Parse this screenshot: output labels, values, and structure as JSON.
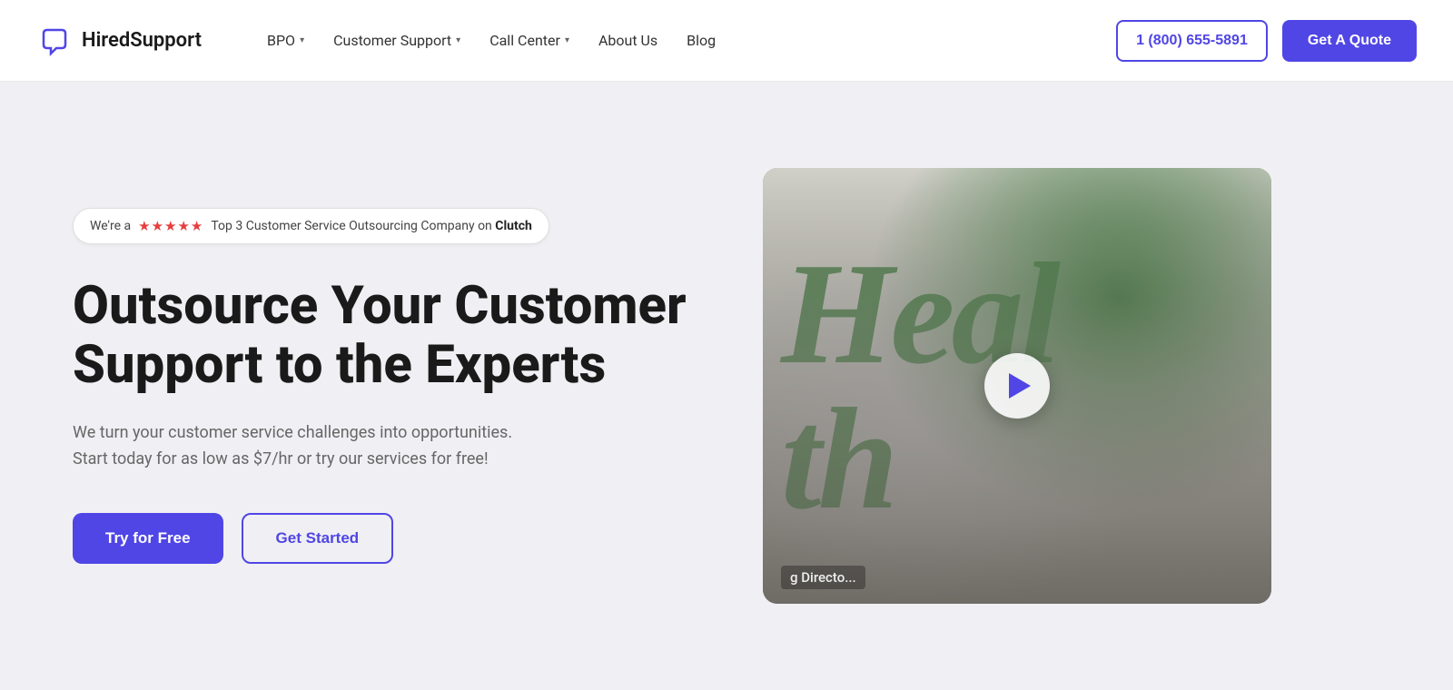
{
  "navbar": {
    "logo_text": "HiredSupport",
    "nav_items": [
      {
        "label": "BPO",
        "has_dropdown": true
      },
      {
        "label": "Customer Support",
        "has_dropdown": true
      },
      {
        "label": "Call Center",
        "has_dropdown": true
      },
      {
        "label": "About Us",
        "has_dropdown": false
      },
      {
        "label": "Blog",
        "has_dropdown": false
      }
    ],
    "phone_label": "1 (800) 655-5891",
    "quote_label": "Get A Quote"
  },
  "hero": {
    "badge_text": "We're a",
    "badge_stars": "★★★★★",
    "badge_suffix": "Top 3 Customer Service Outsourcing Company on",
    "badge_brand": "Clutch",
    "title": "Outsource Your Customer Support to the Experts",
    "subtitle": "We turn your customer service challenges into opportunities. Start today for as low as $7/hr or try our services for free!",
    "btn_primary": "Try for Free",
    "btn_secondary": "Get Started",
    "video_caption": "g Directo..."
  },
  "colors": {
    "accent": "#5046e5",
    "text_dark": "#1a1a1a",
    "text_muted": "#666666",
    "green": "#2d6a2d"
  }
}
